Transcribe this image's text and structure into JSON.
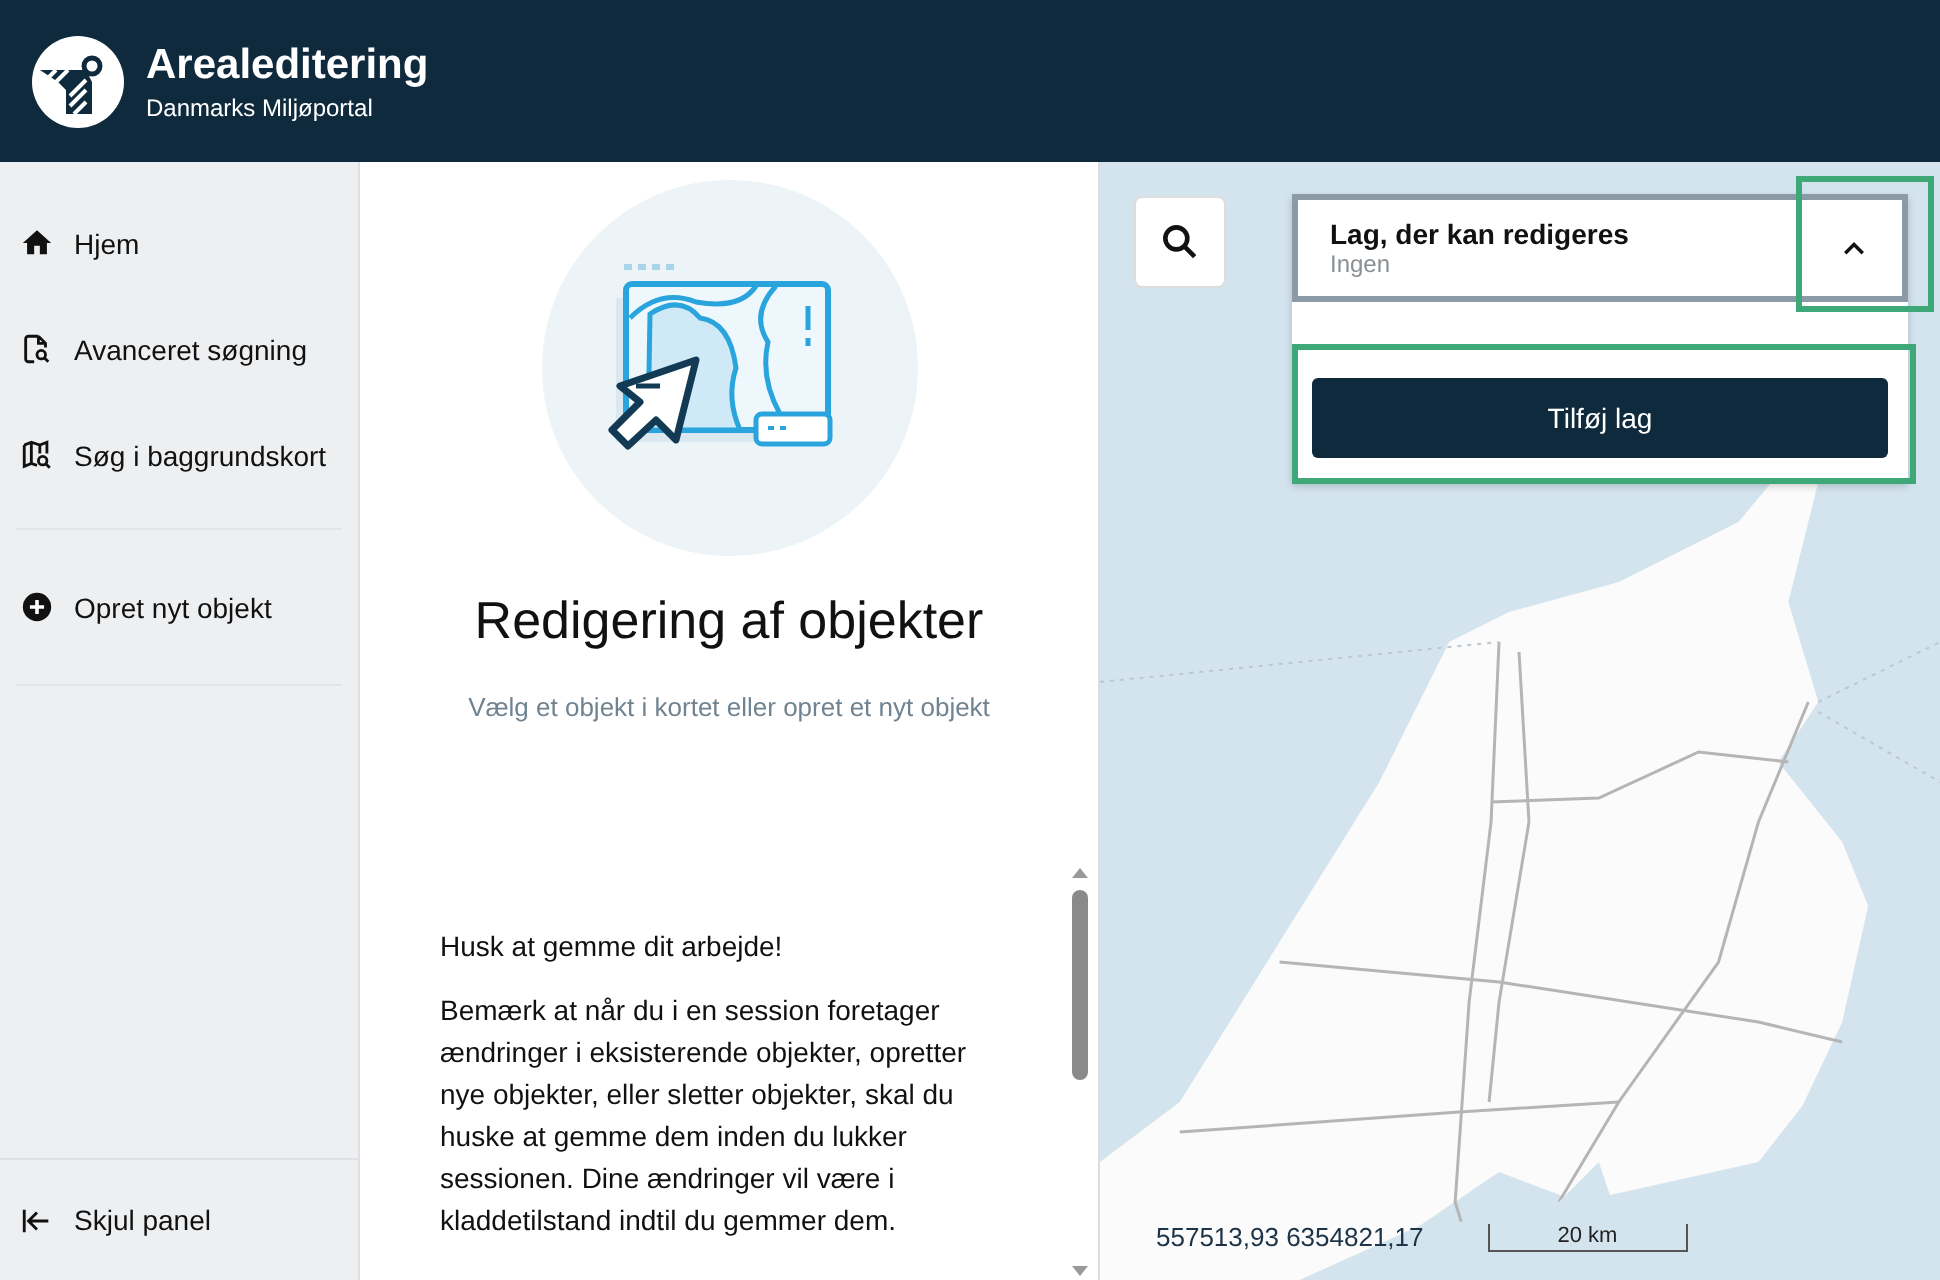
{
  "header": {
    "title": "Arealeditering",
    "subtitle": "Danmarks Miljøportal"
  },
  "nav": {
    "groups": [
      [
        {
          "label": "Hjem"
        },
        {
          "label": "Avanceret søgning"
        },
        {
          "label": "Søg i baggrundskort"
        }
      ],
      [
        {
          "label": "Opret nyt objekt"
        }
      ]
    ],
    "footer": {
      "label": "Skjul panel"
    }
  },
  "panel": {
    "title": "Redigering af objekter",
    "subtitle": "Vælg et objekt i kortet eller opret et nyt objekt",
    "notice": "Husk at gemme dit arbejde!",
    "body": "Bemærk at når du i en session foretager ændringer i eksisterende objekter, opretter nye objekter, eller sletter objekter, skal du huske at gemme dem inden du lukker sessionen. Dine ændringer vil være i kladdetilstand indtil du gemmer dem."
  },
  "map": {
    "layer_panel": {
      "title": "Lag, der kan redigeres",
      "value": "Ingen",
      "expanded": true,
      "button": "Tilføj lag"
    },
    "coordinates": "557513,93 6354821,17",
    "scale": "20 km"
  }
}
